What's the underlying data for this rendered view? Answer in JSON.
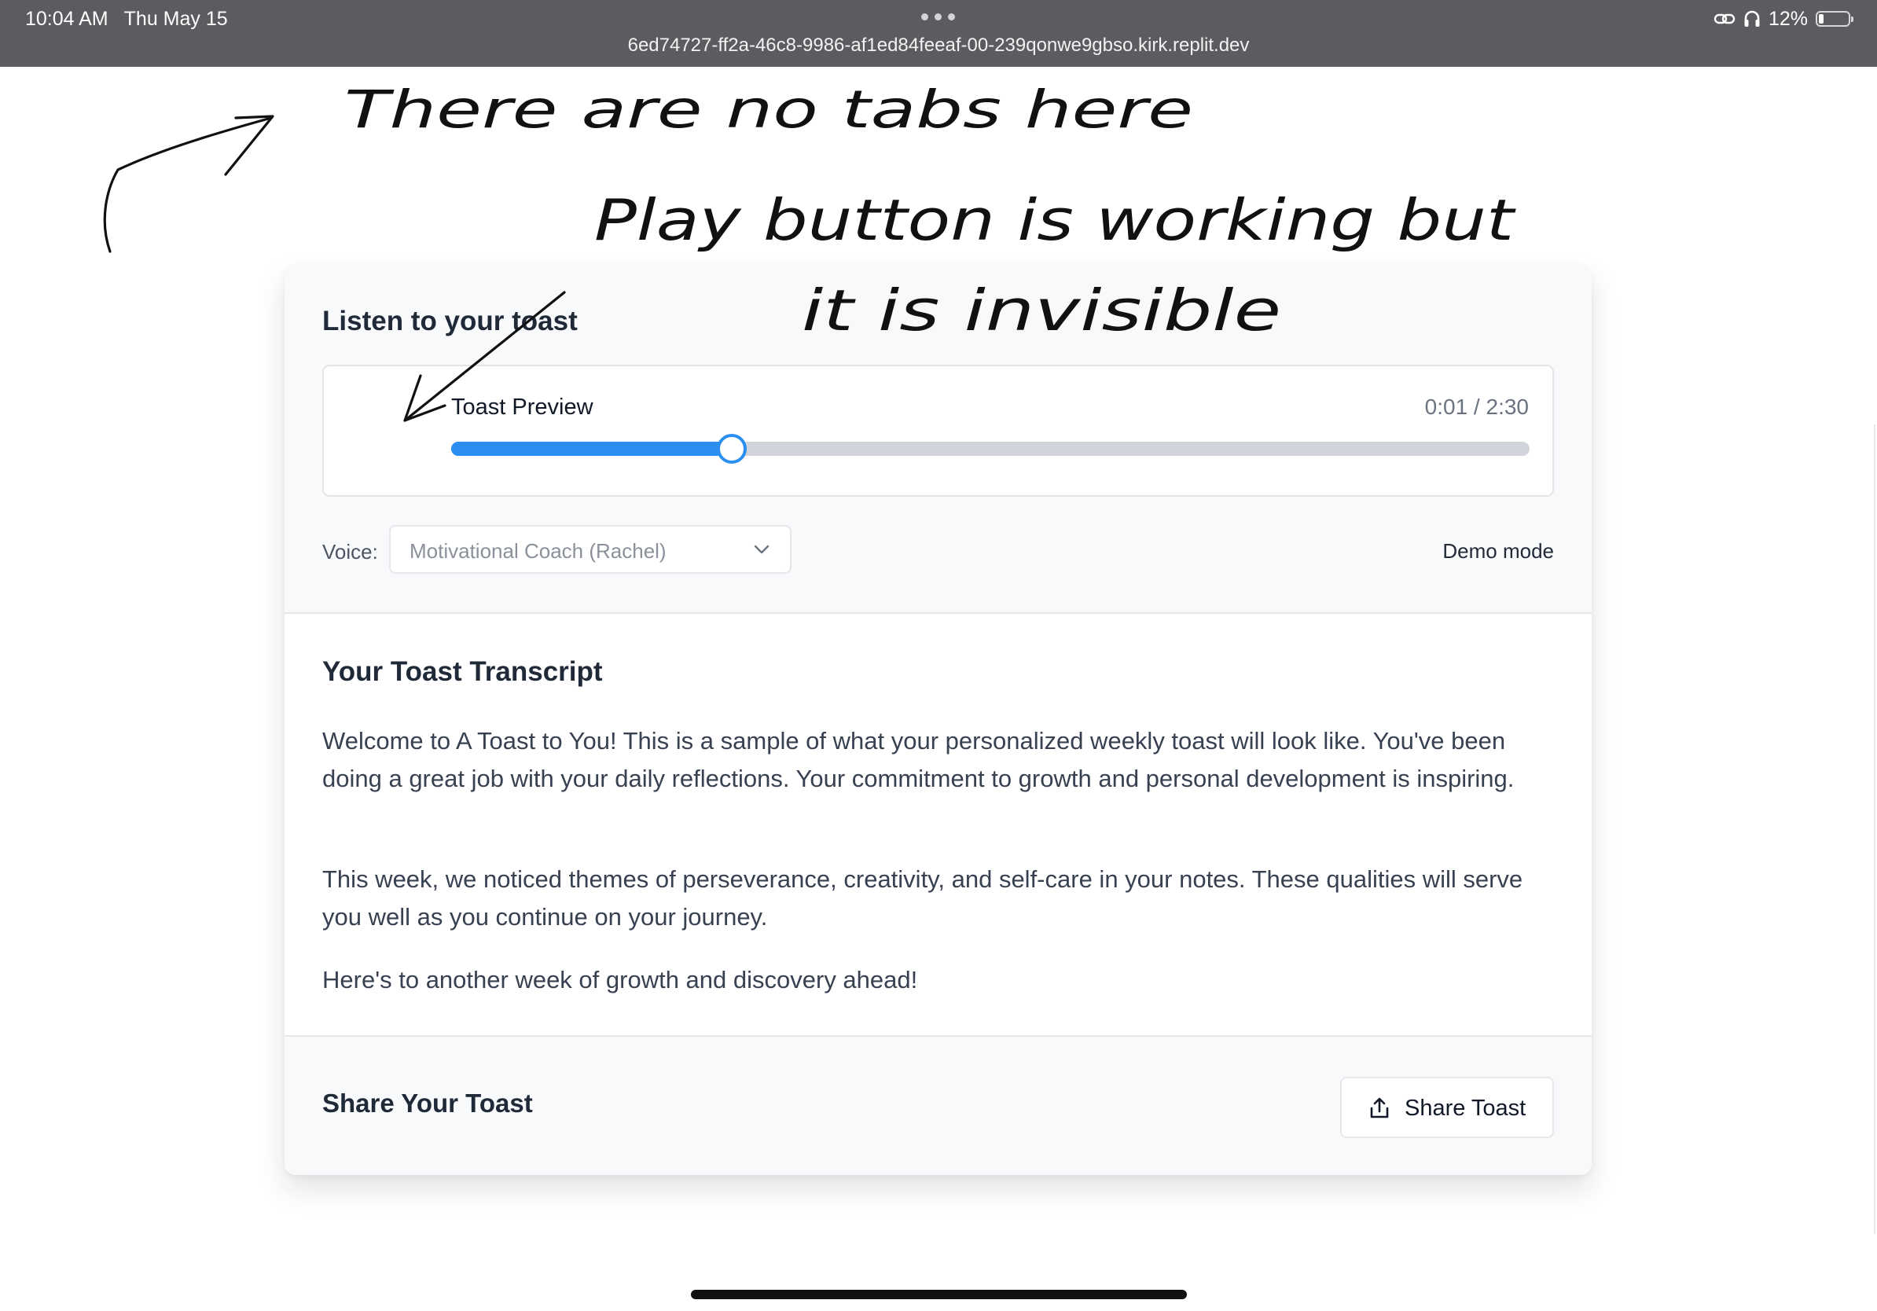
{
  "status_bar": {
    "time": "10:04 AM",
    "date": "Thu May 15",
    "url": "6ed74727-ff2a-46c8-9986-af1ed84feeaf-00-239qonwe9gbso.kirk.replit.dev",
    "battery": "12%",
    "battery_level": 0.12,
    "icons": [
      "more-dots-icon",
      "link-icon",
      "headphones-icon",
      "battery-icon"
    ]
  },
  "listen": {
    "title": "Listen to your toast",
    "player": {
      "track_title": "Toast Preview",
      "time_display": "0:01 / 2:30",
      "progress": 0.26,
      "play_button_visible": false,
      "accent_color": "#2a8ff0"
    },
    "voice": {
      "label": "Voice:",
      "selected": "Motivational Coach (Rachel)",
      "icon": "chevron-down-icon"
    },
    "demo_mode": "Demo mode"
  },
  "transcript": {
    "title": "Your Toast Transcript",
    "paragraphs": [
      "Welcome to A Toast to You! This is a sample of what your personalized weekly toast will look like. You've been doing a great job with your daily reflections. Your commitment to growth and personal development is inspiring.",
      "This week, we noticed themes of perseverance, creativity, and self-care in your notes. These qualities will serve you well as you continue on your journey.",
      "Here's to another week of growth and discovery ahead!"
    ]
  },
  "share": {
    "title": "Share Your Toast",
    "button_label": "Share Toast",
    "button_icon": "share-icon"
  },
  "annotations": {
    "ink_color": "#111111",
    "notes": [
      "There are no tabs here",
      "Play button is working but it is invisible"
    ]
  }
}
